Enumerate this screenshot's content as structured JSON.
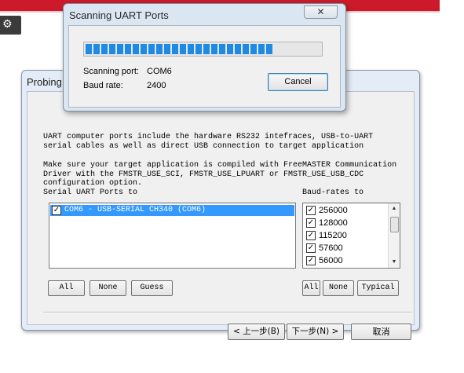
{
  "scanning_dialog": {
    "title": "Scanning UART Ports",
    "close_glyph": "✕",
    "progress_fraction": 0.8,
    "progress_color": "#1f8ae5",
    "port_label": "Scanning port:",
    "port_value": "COM6",
    "baud_label": "Baud rate:",
    "baud_value": "2400",
    "cancel_label": "Cancel"
  },
  "probing_dialog": {
    "title": "Probing",
    "help_text_1": "UART computer ports include the hardware RS232 intefraces, USB-to-UART\nserial cables as well as direct USB connection to target application",
    "help_text_2": "Make sure your target application is compiled with FreeMASTER Communication\nDriver with the FMSTR_USE_SCI, FMSTR_USE_LPUART or FMSTR_USE_USB_CDC\nconfiguration option.",
    "ports_label": "Serial UART Ports to",
    "baud_label": "Baud-rates to",
    "ports": [
      {
        "label": "COM6 - USB-SERIAL CH340 (COM6)",
        "checked": true,
        "selected": true
      }
    ],
    "baud_rates": [
      {
        "label": "256000",
        "checked": true
      },
      {
        "label": "128000",
        "checked": true
      },
      {
        "label": "115200",
        "checked": true
      },
      {
        "label": "57600",
        "checked": true
      },
      {
        "label": "56000",
        "checked": true
      }
    ],
    "check_glyph": "✓",
    "buttons": {
      "all": "All",
      "none": "None",
      "guess": "Guess",
      "all_baud": "All",
      "none_baud": "None",
      "typical": "Typical",
      "prev": "< 上一步(B)",
      "next": "下一步(N) >",
      "cancel": "取消"
    }
  },
  "background": {
    "accent_color": "#cc1a2a",
    "gear_icon": "gear-icon"
  }
}
